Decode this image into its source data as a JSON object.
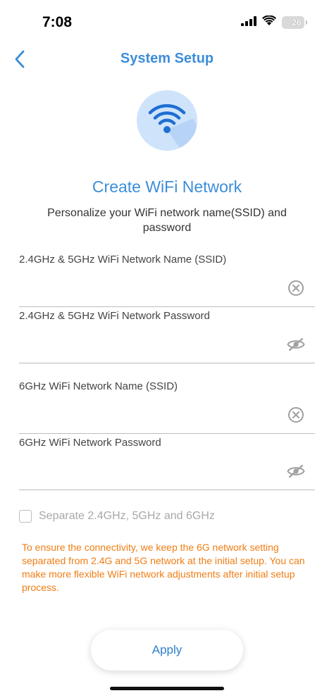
{
  "status_bar": {
    "time": "7:08",
    "battery_level": "26",
    "icons": [
      "signal-icon",
      "wifi-icon",
      "battery-icon"
    ]
  },
  "nav": {
    "title": "System Setup",
    "back_icon": "chevron-left-icon"
  },
  "hero": {
    "icon": "wifi-icon"
  },
  "heading": "Create WiFi Network",
  "subheading": "Personalize your WiFi network name(SSID) and password",
  "fields": [
    {
      "label": "2.4GHz & 5GHz WiFi Network Name (SSID)",
      "value": "",
      "action_icon": "clear-icon"
    },
    {
      "label": "2.4GHz & 5GHz WiFi Network Password",
      "value": "",
      "action_icon": "eye-off-icon"
    },
    {
      "label": "6GHz WiFi Network Name (SSID)",
      "value": "",
      "action_icon": "clear-icon"
    },
    {
      "label": "6GHz WiFi Network Password",
      "value": "",
      "action_icon": "eye-off-icon"
    }
  ],
  "separate_checkbox": {
    "label": "Separate 2.4GHz, 5GHz and 6GHz",
    "checked": false
  },
  "notice": "To ensure the connectivity, we keep the 6G network setting separated from 2.4G and 5G network at the initial setup. You can make more flexible WiFi network adjustments after initial setup process.",
  "apply_label": "Apply",
  "colors": {
    "accent": "#3d8ed9",
    "warning": "#f07d14",
    "hero_bg": "#cfe4fb",
    "hero_wifi": "#1f6fd1"
  }
}
